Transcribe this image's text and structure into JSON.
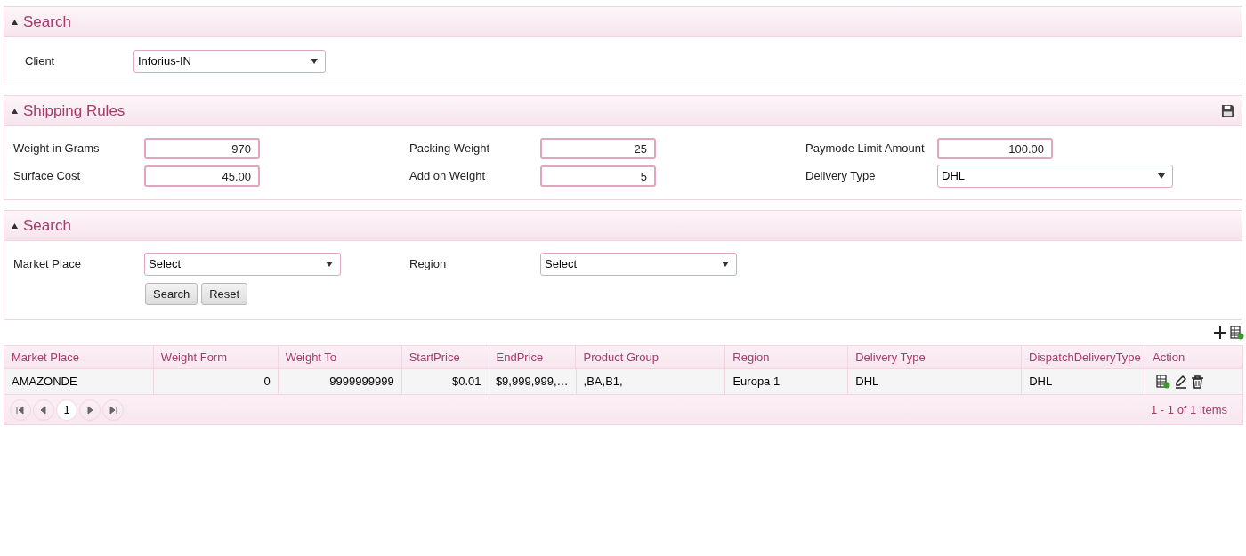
{
  "client_panel": {
    "title": "Search",
    "fields": [
      {
        "label": "Client",
        "value": "Inforius-IN",
        "kind": "select"
      }
    ]
  },
  "shipping_rules": {
    "title": "Shipping Rules",
    "fields": [
      {
        "label": "Weight in Grams",
        "value": "970",
        "kind": "input"
      },
      {
        "label": "Packing Weight",
        "value": "25",
        "kind": "input"
      },
      {
        "label": "Paymode Limit Amount",
        "value": "100.00",
        "kind": "input"
      },
      {
        "label": "Surface Cost",
        "value": "45.00",
        "kind": "input"
      },
      {
        "label": "Add on Weight",
        "value": "5",
        "kind": "input"
      },
      {
        "label": "Delivery Type",
        "value": "DHL",
        "kind": "select"
      }
    ]
  },
  "search_panel": {
    "title": "Search",
    "fields": [
      {
        "label": "Market Place",
        "value": "Select",
        "kind": "select"
      },
      {
        "label": "Region",
        "value": "Select",
        "kind": "select"
      }
    ],
    "buttons": [
      "Search",
      "Reset"
    ]
  },
  "table": {
    "columns": [
      {
        "label": "Market Place",
        "kind": "text"
      },
      {
        "label": "Weight Form",
        "kind": "number"
      },
      {
        "label": "Weight To",
        "kind": "number"
      },
      {
        "label": "StartPrice",
        "kind": "number"
      },
      {
        "label": "EndPrice",
        "kind": "number"
      },
      {
        "label": "Product Group",
        "kind": "text"
      },
      {
        "label": "Region",
        "kind": "text"
      },
      {
        "label": "Delivery Type",
        "kind": "text"
      },
      {
        "label": "DispatchDeliveryType",
        "kind": "text"
      },
      {
        "label": "Action",
        "kind": "action"
      }
    ],
    "rows": [
      {
        "cells": [
          "AMAZONDE",
          "0",
          "9999999999",
          "$0.01",
          "$9,999,999,…",
          ",BA,B1,",
          "Europa 1",
          "DHL",
          "DHL",
          ""
        ]
      }
    ],
    "pages": [
      {
        "label": "1",
        "selected": true
      }
    ],
    "summary": "1 - 1 of 1 items"
  }
}
